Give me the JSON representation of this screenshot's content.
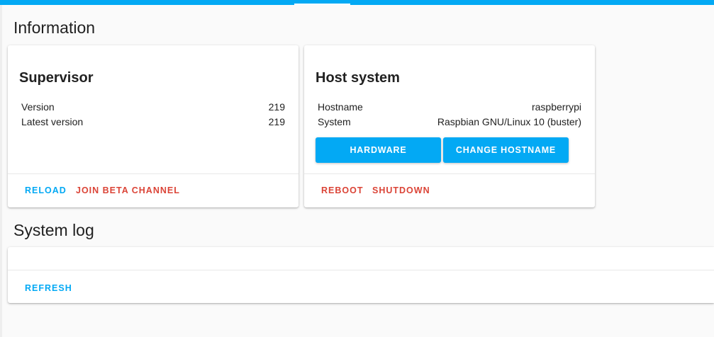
{
  "colors": {
    "primary": "#03a9f4",
    "danger": "#db4437",
    "background": "#fafafa"
  },
  "sections": {
    "information": "Information",
    "system_log": "System log"
  },
  "supervisor": {
    "title": "Supervisor",
    "rows": [
      {
        "label": "Version",
        "value": "219"
      },
      {
        "label": "Latest version",
        "value": "219"
      }
    ],
    "actions": {
      "reload": "RELOAD",
      "join_beta": "JOIN BETA CHANNEL"
    }
  },
  "host": {
    "title": "Host system",
    "rows": [
      {
        "label": "Hostname",
        "value": "raspberrypi"
      },
      {
        "label": "System",
        "value": "Raspbian GNU/Linux 10 (buster)"
      }
    ],
    "buttons": {
      "hardware": "HARDWARE",
      "change_hostname": "CHANGE HOSTNAME"
    },
    "actions": {
      "reboot": "REBOOT",
      "shutdown": "SHUTDOWN"
    }
  },
  "log": {
    "actions": {
      "refresh": "REFRESH"
    }
  }
}
